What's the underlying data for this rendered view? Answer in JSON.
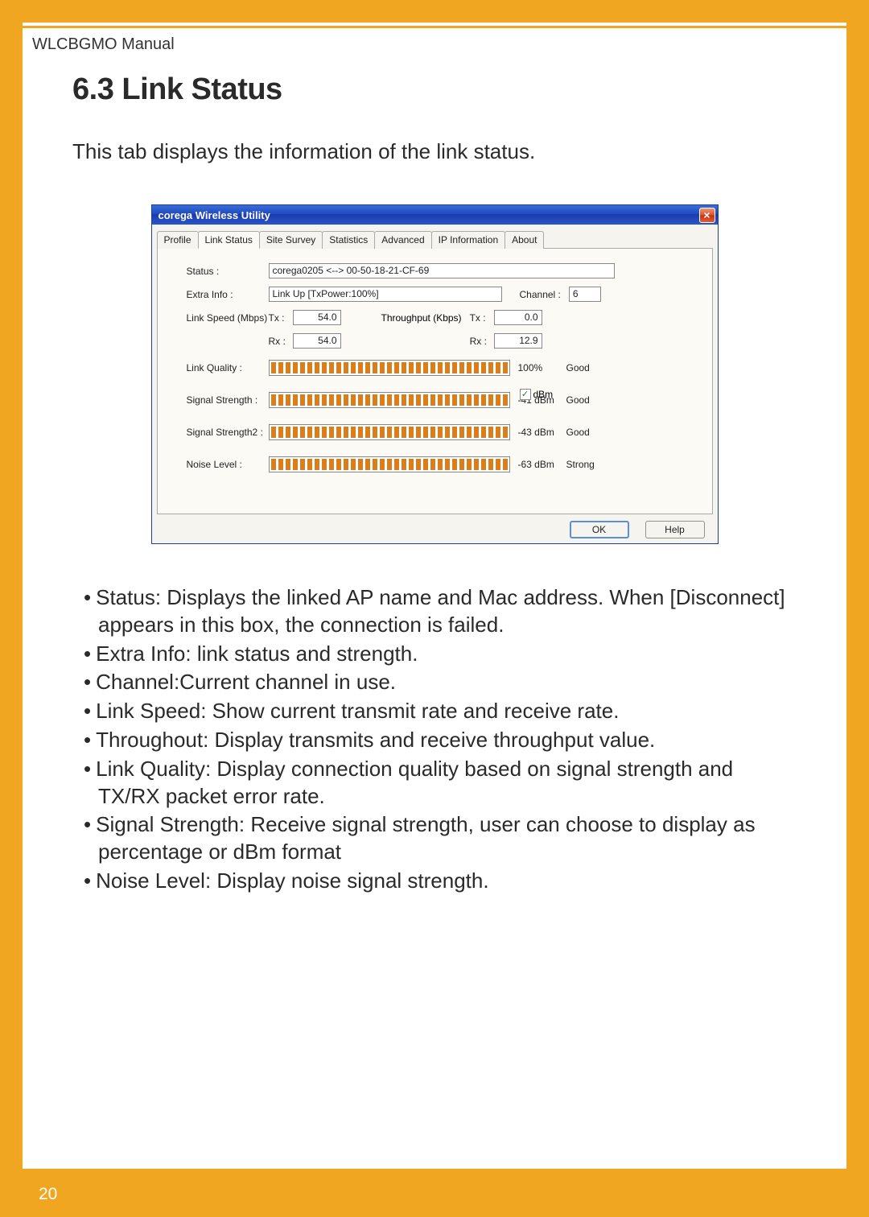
{
  "header": {
    "manual_label": "WLCBGMO  Manual"
  },
  "section": {
    "heading": "6.3 Link Status",
    "intro": "This tab displays the information of the link status."
  },
  "window": {
    "title": "corega Wireless Utility",
    "close_glyph": "×",
    "tabs": [
      "Profile",
      "Link Status",
      "Site Survey",
      "Statistics",
      "Advanced",
      "IP Information",
      "About"
    ],
    "active_tab_index": 1,
    "labels": {
      "status": "Status :",
      "extra_info": "Extra Info :",
      "channel": "Channel :",
      "link_speed": "Link Speed (Mbps)",
      "throughput": "Throughput (Kbps)",
      "tx": "Tx :",
      "rx": "Rx :",
      "link_quality": "Link Quality :",
      "signal_strength": "Signal Strength :",
      "signal_strength2": "Signal Strength2 :",
      "noise_level": "Noise Level :",
      "dbm": "dBm"
    },
    "values": {
      "status": "corega0205 <--> 00-50-18-21-CF-69",
      "extra_info": "Link Up [TxPower:100%]",
      "channel": "6",
      "tx_speed": "54.0",
      "rx_speed": "54.0",
      "tx_throughput": "0.0",
      "rx_throughput": "12.9",
      "link_quality_pct": "100%",
      "link_quality_rating": "Good",
      "signal_strength_val": "-41 dBm",
      "signal_strength_rating": "Good",
      "signal_strength2_val": "-43 dBm",
      "signal_strength2_rating": "Good",
      "noise_level_val": "-63 dBm",
      "noise_level_rating": "Strong"
    },
    "buttons": {
      "ok": "OK",
      "help": "Help"
    }
  },
  "bullets": [
    "Status: Displays the linked AP name and  Mac address. When [Disconnect] appears in this box, the connection is failed.",
    "Extra Info: link status and strength.",
    "Channel:Current channel in use.",
    "Link Speed: Show current transmit rate and receive rate.",
    "Throughout: Display transmits and receive throughput value.",
    "Link Quality: Display connection quality based on signal strength and TX/RX packet error rate.",
    "Signal Strength: Receive signal strength, user can choose to display as percentage or dBm format",
    "Noise Level: Display noise signal strength."
  ],
  "page_number": "20"
}
